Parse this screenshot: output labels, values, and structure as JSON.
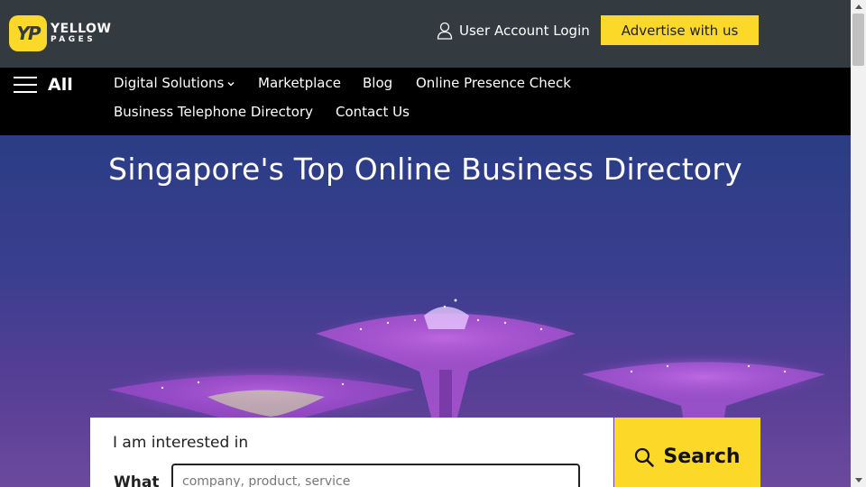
{
  "header": {
    "logo_mark": "YP",
    "logo_line1": "YELLOW",
    "logo_line2": "PAGES",
    "account_label": "User Account Login",
    "advertise_label": "Advertise with us"
  },
  "nav": {
    "all_label": "All",
    "items": [
      {
        "label": "Digital Solutions"
      },
      {
        "label": "Marketplace"
      },
      {
        "label": "Blog"
      },
      {
        "label": "Online Presence Check"
      },
      {
        "label": "Business Telephone Directory"
      },
      {
        "label": "Contact Us"
      }
    ]
  },
  "hero": {
    "title": "Singapore's Top Online Business Directory"
  },
  "search": {
    "interest_label": "I am interested in",
    "what_label": "What",
    "what_placeholder": "company, product, service",
    "button_label": "Search"
  },
  "colors": {
    "brand_yellow": "#fcd829",
    "topbar": "#333a40",
    "navbar": "#000000"
  },
  "icons": {
    "account": "user-outline-icon",
    "nav_menu": "hamburger-icon",
    "dropdown": "chevron-down-icon",
    "search": "magnifier-icon"
  }
}
